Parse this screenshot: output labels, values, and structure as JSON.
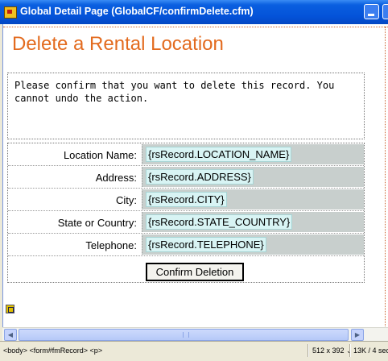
{
  "window": {
    "title": "Global Detail Page (GlobalCF/confirmDelete.cfm)"
  },
  "page": {
    "heading": "Delete a Rental Location",
    "message": "Please confirm that you want to delete this record. You cannot undo the action."
  },
  "form": {
    "rows": [
      {
        "label": "Location Name:",
        "value": "{rsRecord.LOCATION_NAME}"
      },
      {
        "label": "Address:",
        "value": "{rsRecord.ADDRESS}"
      },
      {
        "label": "City:",
        "value": "{rsRecord.CITY}"
      },
      {
        "label": "State or Country:",
        "value": "{rsRecord.STATE_COUNTRY}"
      },
      {
        "label": "Telephone:",
        "value": "{rsRecord.TELEPHONE}"
      }
    ],
    "submit_label": "Confirm Deletion"
  },
  "statusbar": {
    "tag_selector": "<body> <form#fmRecord> <p>",
    "window_size": "512 x 392 ⌄",
    "file_size": "13K / 4 sec"
  },
  "colors": {
    "heading": "#e36b1f",
    "titlebar": "#0452d8",
    "value_cell": "#c8cfcd"
  }
}
